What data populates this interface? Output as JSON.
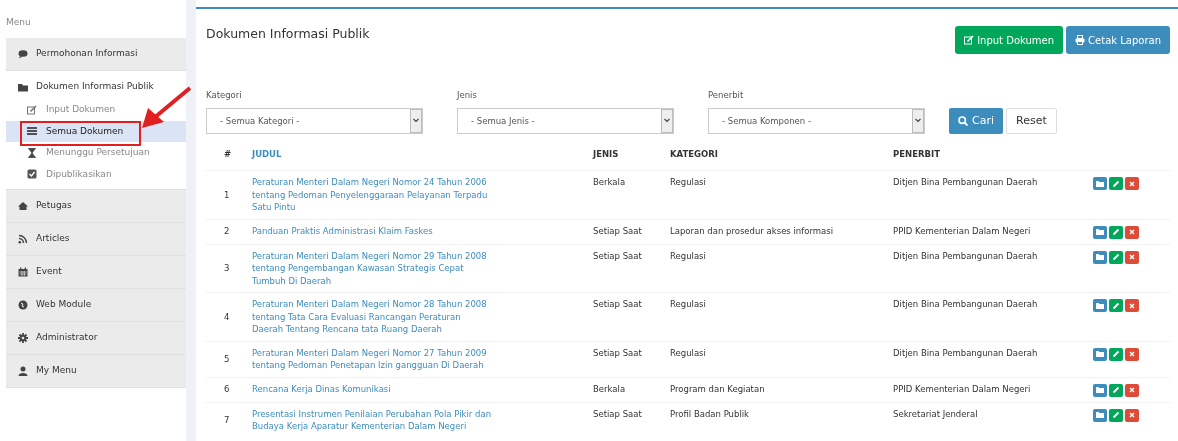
{
  "sidebar": {
    "label": "Menu",
    "items": [
      {
        "label": "Permohonan Informasi",
        "expanded": false
      },
      {
        "label": "Dokumen Informasi Publik",
        "expanded": true,
        "children": [
          {
            "label": "Input Dokumen",
            "selected": false
          },
          {
            "label": "Semua Dokumen",
            "selected": true
          },
          {
            "label": "Menunggu Persetujuan",
            "selected": false
          },
          {
            "label": "Dipublikasikan",
            "selected": false
          }
        ]
      },
      {
        "label": "Petugas",
        "expanded": false
      },
      {
        "label": "Articles",
        "expanded": false
      },
      {
        "label": "Event",
        "expanded": false
      },
      {
        "label": "Web Module",
        "expanded": false
      },
      {
        "label": "Administrator",
        "expanded": false
      },
      {
        "label": "My Menu",
        "expanded": false
      }
    ]
  },
  "page": {
    "title": "Dokumen Informasi Publik",
    "buttons": [
      {
        "label": "Input Dokumen",
        "kind": "input"
      },
      {
        "label": "Cetak Laporan",
        "kind": "print"
      }
    ]
  },
  "filters": [
    {
      "label": "Kategori",
      "value": "- Semua Kategori -"
    },
    {
      "label": "Jenis",
      "value": "- Semua Jenis -"
    },
    {
      "label": "Penerbit",
      "value": "- Semua Komponen -"
    }
  ],
  "filter_buttons": [
    {
      "label": "Cari",
      "kind": "search"
    },
    {
      "label": "Reset",
      "kind": "reset"
    }
  ],
  "table": {
    "columns": [
      "#",
      "JUDUL",
      "JENIS",
      "KATEGORI",
      "PENERBIT"
    ],
    "rows": [
      {
        "no": "1",
        "judul": "Peraturan Menteri Dalam Negeri Nomor 24 Tahun 2006 tentang Pedoman Penyelenggaraan Pelayanan Terpadu Satu Pintu",
        "jenis": "Berkala",
        "kategori": "Regulasi",
        "penerbit": "Ditjen Bina Pembangunan Daerah"
      },
      {
        "no": "2",
        "judul": "Panduan Praktis Administrasi Klaim Faskes",
        "jenis": "Setiap Saat",
        "kategori": "Laporan dan prosedur akses informasi",
        "penerbit": "PPID Kementerian Dalam Negeri"
      },
      {
        "no": "3",
        "judul": "Peraturan Menteri Dalam Negeri Nomor 29 Tahun 2008 tentang Pengembangan Kawasan Strategis Cepat Tumbuh Di Daerah",
        "jenis": "Setiap Saat",
        "kategori": "Regulasi",
        "penerbit": "Ditjen Bina Pembangunan Daerah"
      },
      {
        "no": "4",
        "judul": "Peraturan Menteri Dalam Negeri Nomor 28 Tahun 2008 tentang Tata Cara Evaluasi Rancangan Peraturan Daerah Tentang Rencana tata Ruang Daerah",
        "jenis": "Setiap Saat",
        "kategori": "Regulasi",
        "penerbit": "Ditjen Bina Pembangunan Daerah"
      },
      {
        "no": "5",
        "judul": "Peraturan Menteri Dalam Negeri Nomor 27 Tahun 2009 tentang Pedoman Penetapan Izin gangguan Di Daerah",
        "jenis": "Setiap Saat",
        "kategori": "Regulasi",
        "penerbit": "Ditjen Bina Pembangunan Daerah"
      },
      {
        "no": "6",
        "judul": "Rencana Kerja Dinas Komunikasi",
        "jenis": "Berkala",
        "kategori": "Program dan Kegiatan",
        "penerbit": "PPID Kementerian Dalam Negeri"
      },
      {
        "no": "7",
        "judul": "Presentasi Instrumen Penilaian Perubahan Pola Pikir dan Budaya Kerja Aparatur Kementerian Dalam Negeri",
        "jenis": "Setiap Saat",
        "kategori": "Profil Badan Publik",
        "penerbit": "Sekretariat Jenderal"
      }
    ]
  }
}
